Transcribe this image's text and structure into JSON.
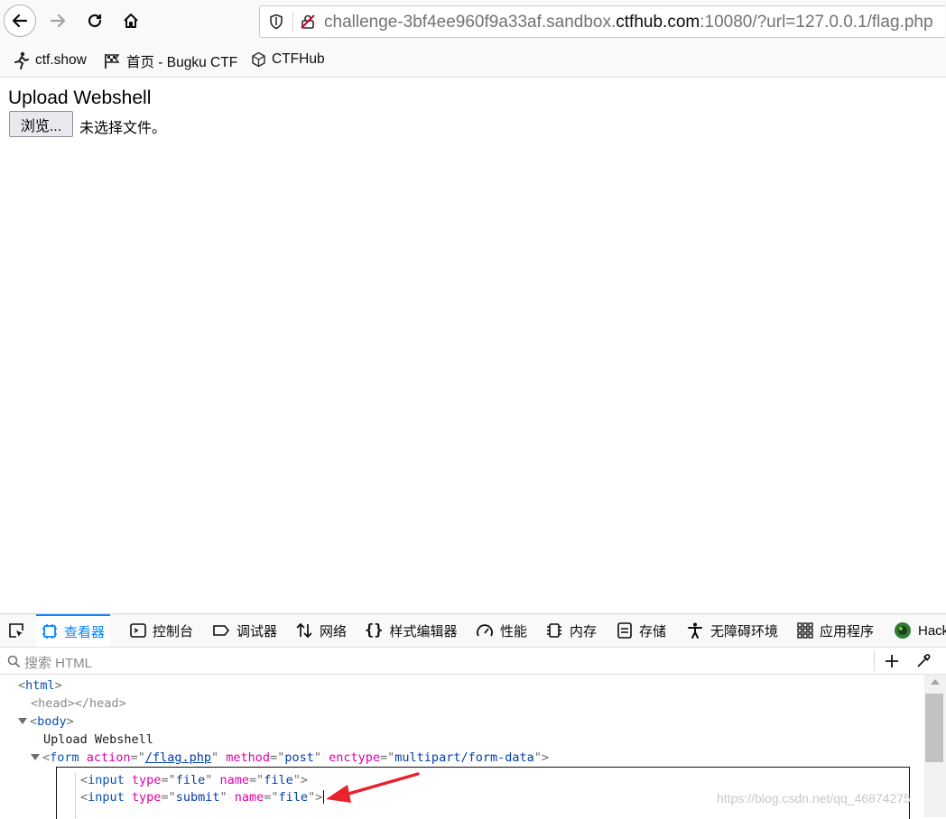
{
  "browser": {
    "url_prefix": "challenge-3bf4ee960f9a33af.sandbox.",
    "url_domain": "ctfhub.com",
    "url_suffix": ":10080/?url=127.0.0.1/flag.php",
    "bookmarks": [
      {
        "label": "ctf.show",
        "icon": "runner-icon"
      },
      {
        "label": "首页 - Bugku CTF",
        "icon": "flag-icon"
      },
      {
        "label": "CTFHub",
        "icon": "cube-icon"
      }
    ]
  },
  "page": {
    "title": "Upload Webshell",
    "browse_label": "浏览...",
    "no_file_label": "未选择文件。"
  },
  "devtools": {
    "tabs": [
      "查看器",
      "控制台",
      "调试器",
      "网络",
      "样式编辑器",
      "性能",
      "内存",
      "存储",
      "无障碍环境",
      "应用程序",
      "Hack"
    ],
    "active_tab": "查看器",
    "search_placeholder": "搜索 HTML",
    "tree": {
      "html": "html",
      "head": "head",
      "body": "body",
      "body_text": "Upload Webshell",
      "form": "form",
      "form_action_attr": "action",
      "form_action_val": "/flag.php",
      "form_method_attr": "method",
      "form_method_val": "post",
      "form_enctype_attr": "enctype",
      "form_enctype_val": "multipart/form-data",
      "input": "input",
      "type_attr": "type",
      "name_attr": "name",
      "input1_type": "file",
      "input1_name": "file",
      "input2_type": "submit",
      "input2_name": "file"
    }
  },
  "watermark": "https://blog.csdn.net/qq_46874275",
  "colors": {
    "accent": "#0a84ff",
    "arrow": "#e8232b"
  }
}
